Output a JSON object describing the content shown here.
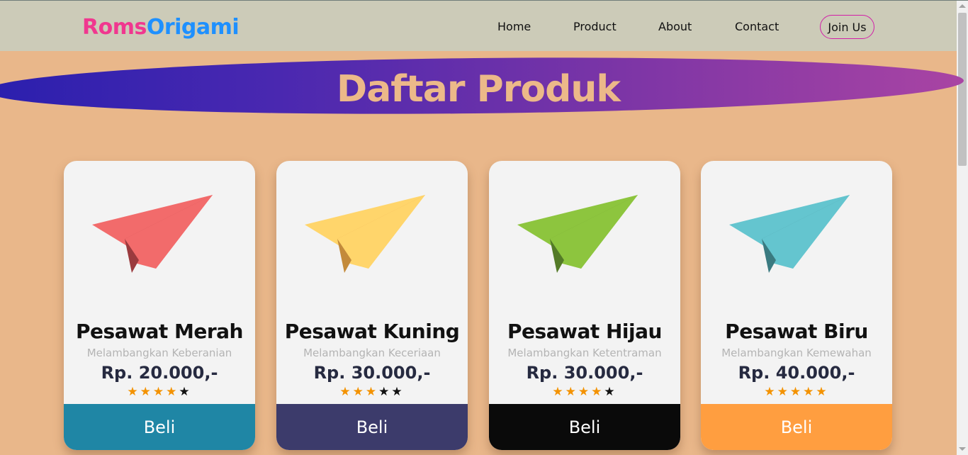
{
  "brand": {
    "part1": "Roms",
    "part2": "Origami"
  },
  "nav": {
    "home": "Home",
    "product": "Product",
    "about": "About",
    "contact": "Contact",
    "join": "Join Us"
  },
  "banner": {
    "title": "Daftar Produk"
  },
  "products": [
    {
      "name": "Pesawat Merah",
      "desc": "Melambangkan Keberanian",
      "price": "Rp. 20.000,-",
      "rating": 4,
      "button": "Beli",
      "plane_color": "#f26b6b",
      "plane_shade": "#c84e52",
      "plane_dark": "#9b3a3e",
      "button_color": "#1f86a5"
    },
    {
      "name": "Pesawat Kuning",
      "desc": "Melambangkan Keceriaan",
      "price": "Rp. 30.000,-",
      "rating": 3,
      "button": "Beli",
      "plane_color": "#ffd56b",
      "plane_shade": "#e8a84a",
      "plane_dark": "#c38a3b",
      "button_color": "#3c3b6b"
    },
    {
      "name": "Pesawat Hijau",
      "desc": "Melambangkan Ketentraman",
      "price": "Rp. 30.000,-",
      "rating": 4,
      "button": "Beli",
      "plane_color": "#8dc53e",
      "plane_shade": "#6c9c32",
      "plane_dark": "#537a27",
      "button_color": "#0a0a0a"
    },
    {
      "name": "Pesawat Biru",
      "desc": "Melambangkan Kemewahan",
      "price": "Rp. 40.000,-",
      "rating": 5,
      "button": "Beli",
      "plane_color": "#64c5cf",
      "plane_shade": "#4a959c",
      "plane_dark": "#3a7a80",
      "button_color": "#ff9e40"
    }
  ],
  "icons": {
    "star": "star-icon",
    "plane": "paper-plane-icon"
  }
}
